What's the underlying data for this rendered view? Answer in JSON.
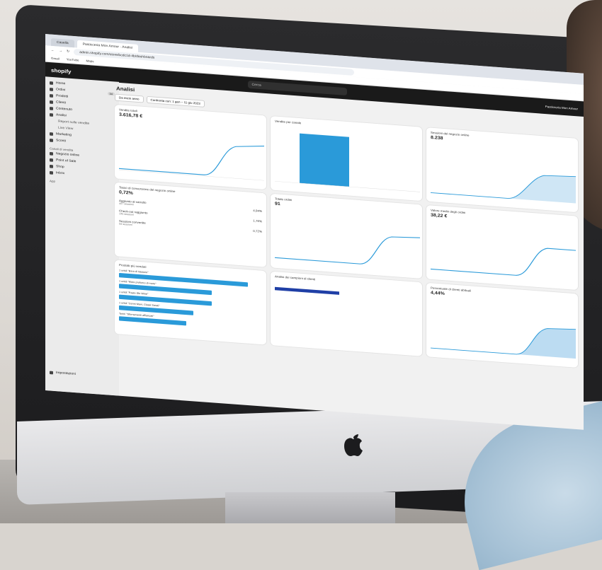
{
  "browser": {
    "tabs": [
      "Casella",
      "Pasticceria Mon Amour · Analisi"
    ],
    "url": "admin.shopify.com/store/bcdc1d-4b/dashboards",
    "bookmarks": [
      "Gmail",
      "YouTube",
      "Maps"
    ]
  },
  "topbar": {
    "logo": "shopify",
    "search_placeholder": "Cerca",
    "store_name": "Pasticceria Mon Amour"
  },
  "sidebar": {
    "items": [
      {
        "label": "Home"
      },
      {
        "label": "Ordini",
        "badge": "34"
      },
      {
        "label": "Prodotti"
      },
      {
        "label": "Clienti"
      },
      {
        "label": "Contenuto"
      },
      {
        "label": "Analisi"
      }
    ],
    "sub_items": [
      "Report sulle vendite",
      "Live View"
    ],
    "items2": [
      {
        "label": "Marketing"
      },
      {
        "label": "Sconti"
      }
    ],
    "channels_title": "Canali di vendita",
    "channels": [
      "Negozio online",
      "Point of Sale",
      "Shop",
      "Inbox"
    ],
    "apps_title": "App",
    "settings": "Impostazioni"
  },
  "main": {
    "title": "Analisi",
    "filter_date": "Da inizio anno",
    "filter_compare": "Confronta con: 1 gen – 11 giu 2023",
    "cards": [
      {
        "title": "Vendite totali",
        "value": "3.616,78 €"
      },
      {
        "title": "Vendite per canale",
        "value": ""
      },
      {
        "title": "Sessioni del negozio online",
        "value": "8.238"
      },
      {
        "title": "Tasso di conversione del negozio online",
        "value": "0,72%"
      },
      {
        "title": "Totale ordini",
        "value": "91"
      },
      {
        "title": "Valore medio degli ordini",
        "value": "38,22 €"
      },
      {
        "title": "Prodotti più venduti",
        "value": ""
      },
      {
        "title": "Analisi dei campioni di clienti",
        "value": ""
      },
      {
        "title": "Percentuale di clienti abituali",
        "value": "4,44%"
      }
    ],
    "conversion_rows": [
      {
        "label": "Aggiunto al carrello",
        "sessions": "407 sessioni",
        "pct": "4,94%"
      },
      {
        "label": "Check-out raggiunto",
        "sessions": "145 sessioni",
        "pct": "1,76%"
      },
      {
        "label": "Sessioni convertite",
        "sessions": "59 sessioni",
        "pct": "0,72%"
      }
    ],
    "top_products": [
      {
        "label": "1 unità \"Bara di Vassoio\"",
        "value": "19",
        "share": 1.0
      },
      {
        "label": "1 unità \"Mare profumo di mare\"",
        "value": "13",
        "share": 0.72
      },
      {
        "label": "1 unità \"Pasta Sfo Wine\"",
        "value": "13",
        "share": 0.72
      },
      {
        "label": "1 unità \"Cenni Mavi, Classi Sarati\"",
        "value": "8",
        "share": 0.58
      },
      {
        "label": "Torini \"Sfornamenti affiancati\"",
        "value": "7",
        "share": 0.52
      }
    ]
  },
  "colors": {
    "accent": "#2a9ad9",
    "dark": "#1a1a1a"
  }
}
